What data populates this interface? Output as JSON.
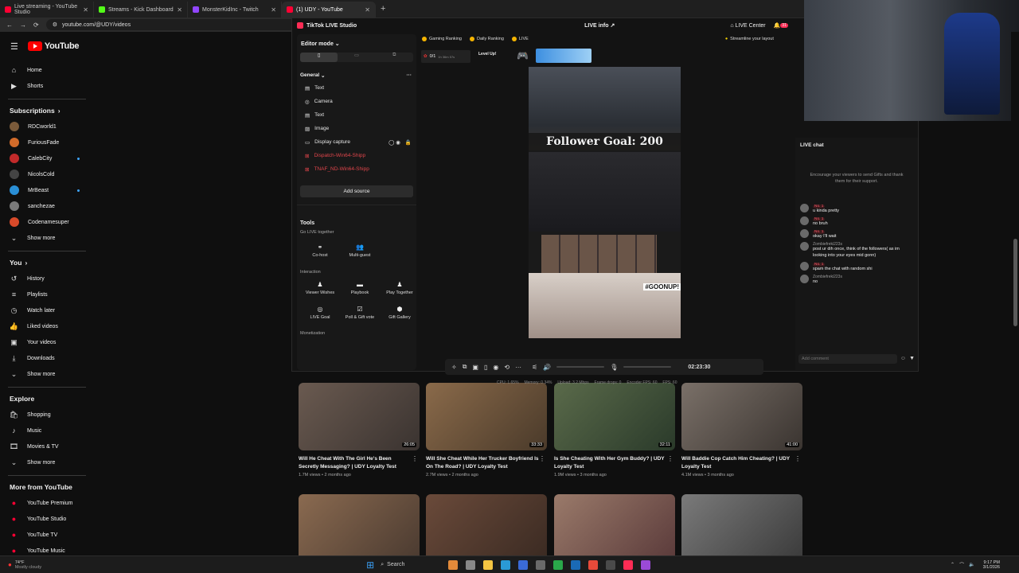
{
  "browser": {
    "tabs": [
      {
        "label": "Live streaming - YouTube Studio",
        "color": "#ff0033"
      },
      {
        "label": "Streams - Kick Dashboard",
        "color": "#53fc18"
      },
      {
        "label": "MonsterKidInc - Twitch",
        "color": "#9146ff"
      },
      {
        "label": "(1) UDY - YouTube",
        "color": "#ff0033"
      }
    ],
    "new_tab": "+",
    "url": "youtube.com/@UDY/videos"
  },
  "youtube": {
    "logo": "YouTube",
    "nav": [
      {
        "icon": "home-icon",
        "label": "Home"
      },
      {
        "icon": "shorts-icon",
        "label": "Shorts"
      }
    ],
    "subscriptions_header": "Subscriptions",
    "subscriptions": [
      {
        "label": "RDCworld1",
        "color": "#7a5a3a",
        "live": false
      },
      {
        "label": "FuriousFade",
        "color": "#d26b2a",
        "live": false
      },
      {
        "label": "CalebCity",
        "color": "#c22a2a",
        "live": true
      },
      {
        "label": "NicolsCold",
        "color": "#444444",
        "live": false
      },
      {
        "label": "MrBeast",
        "color": "#2a8fd6",
        "live": true
      },
      {
        "label": "sanchezae",
        "color": "#7a7a7a",
        "live": false
      },
      {
        "label": "Codenamesuper",
        "color": "#d84a2a",
        "live": false
      }
    ],
    "show_more": "Show more",
    "you_header": "You",
    "you_items": [
      {
        "icon": "history-icon",
        "label": "History"
      },
      {
        "icon": "playlists-icon",
        "label": "Playlists"
      },
      {
        "icon": "watch-later-icon",
        "label": "Watch later"
      },
      {
        "icon": "liked-icon",
        "label": "Liked videos"
      },
      {
        "icon": "your-videos-icon",
        "label": "Your videos"
      },
      {
        "icon": "downloads-icon",
        "label": "Downloads"
      }
    ],
    "show_more_2": "Show more",
    "explore_header": "Explore",
    "explore_items": [
      {
        "icon": "shopping-icon",
        "label": "Shopping"
      },
      {
        "icon": "music-icon",
        "label": "Music"
      },
      {
        "icon": "movies-icon",
        "label": "Movies & TV"
      }
    ],
    "show_more_3": "Show more",
    "more_header": "More from YouTube",
    "more_items": [
      {
        "label": "YouTube Premium"
      },
      {
        "label": "YouTube Studio"
      },
      {
        "label": "YouTube TV"
      },
      {
        "label": "YouTube Music"
      }
    ],
    "videos": [
      {
        "title": "Will He Cheat With The Girl He's Been Secretly Messaging? | UDY Loyalty Test",
        "meta": "1.7M views • 2 months ago",
        "duration": "26:05",
        "color": "#6a5a50"
      },
      {
        "title": "Will She Cheat While Her Trucker Boyfriend Is On The Road? | UDY Loyalty Test",
        "meta": "2.7M views • 2 months ago",
        "duration": "33:33",
        "color": "#8a6a4a"
      },
      {
        "title": "Is She Cheating With Her Gym Buddy? | UDY Loyalty Test",
        "meta": "1.9M views • 3 months ago",
        "duration": "32:11",
        "color": "#5a6a4a"
      },
      {
        "title": "Will Baddie Cop Catch Him Cheating? | UDY Loyalty Test",
        "meta": "4.1M views • 3 months ago",
        "duration": "41:00",
        "color": "#7a7068"
      },
      {
        "title": "",
        "meta": "",
        "duration": "",
        "color": "#8a6a50"
      },
      {
        "title": "",
        "meta": "",
        "duration": "",
        "color": "#6a4a3a"
      },
      {
        "title": "",
        "meta": "",
        "duration": "",
        "color": "#9a7a6a"
      },
      {
        "title": "",
        "meta": "",
        "duration": "",
        "color": "#7a7a7a"
      }
    ]
  },
  "studio": {
    "title": "TikTok LIVE Studio",
    "live_info": "LIVE info",
    "live_center": "LIVE Center",
    "notif_count": "31",
    "editor_mode": "Editor mode",
    "general": "General",
    "sources": [
      {
        "icon": "text-icon",
        "label": "Text",
        "red": false
      },
      {
        "icon": "camera-icon",
        "label": "Camera",
        "red": false
      },
      {
        "icon": "text-icon",
        "label": "Text",
        "red": false
      },
      {
        "icon": "image-icon",
        "label": "Image",
        "red": false
      },
      {
        "icon": "display-icon",
        "label": "Display capture",
        "red": false
      },
      {
        "icon": "warning-icon",
        "label": "Dispatch-Win64-Shipp",
        "red": true
      },
      {
        "icon": "warning-icon",
        "label": "TNAF_ND-Win64-Shipp",
        "red": true
      }
    ],
    "add_source": "Add source",
    "tools": "Tools",
    "go_live_together": "Go LIVE together",
    "cohost": "Co-host",
    "multi_guest": "Multi-guest",
    "interaction": "Interaction",
    "viewer_wishes": "Viewer Wishes",
    "playbook": "Playbook",
    "play_together": "Play Together",
    "live_goal": "LIVE Goal",
    "poll_gift_vote": "Poll & Gift vote",
    "gift_gallery": "Gift Gallery",
    "monetization": "Monetization",
    "gaming_ranking": "Gaming Ranking",
    "daily_ranking": "Daily Ranking",
    "live_chip": "LIVE",
    "streamline": "Streamline your layout",
    "goal_progress": "0/1",
    "goal_timer": "1h 36m 57s",
    "level_up": "Level Up!",
    "follower_goal": "Follower Goal: 200",
    "goonup": "#GOONUP!",
    "timer": "02:23:30",
    "stats": "CPU: 1.65%     Memory: 0.34%     Upload: 3.2 Mbps     Frame drops: 0     Encoder FPS: 60     FPS: 60",
    "live_chat": "LIVE chat",
    "chat_hint": "Encourage your viewers to send Gifts and thank them for their support.",
    "chat": [
      {
        "user": "",
        "badge": "No. 1",
        "text": "u kinda pretty"
      },
      {
        "user": "",
        "badge": "No. 1",
        "text": "no bruh"
      },
      {
        "user": "",
        "badge": "No. 1",
        "text": "okay I'll wait"
      },
      {
        "user": "Zombiefreki223s",
        "badge": "",
        "text": "post ur dih once, think of the followers( as im looking into your eyes mid gonn)"
      },
      {
        "user": "",
        "badge": "No. 1",
        "text": "spam the chat with random shi"
      },
      {
        "user": "Zombiefreki223s",
        "badge": "",
        "text": "no"
      }
    ],
    "add_comment": "Add comment"
  },
  "taskbar": {
    "weather_temp": "74°F",
    "weather_desc": "Mostly cloudy",
    "search": "Search",
    "time": "9:17 PM",
    "date": "3/1/2026"
  }
}
